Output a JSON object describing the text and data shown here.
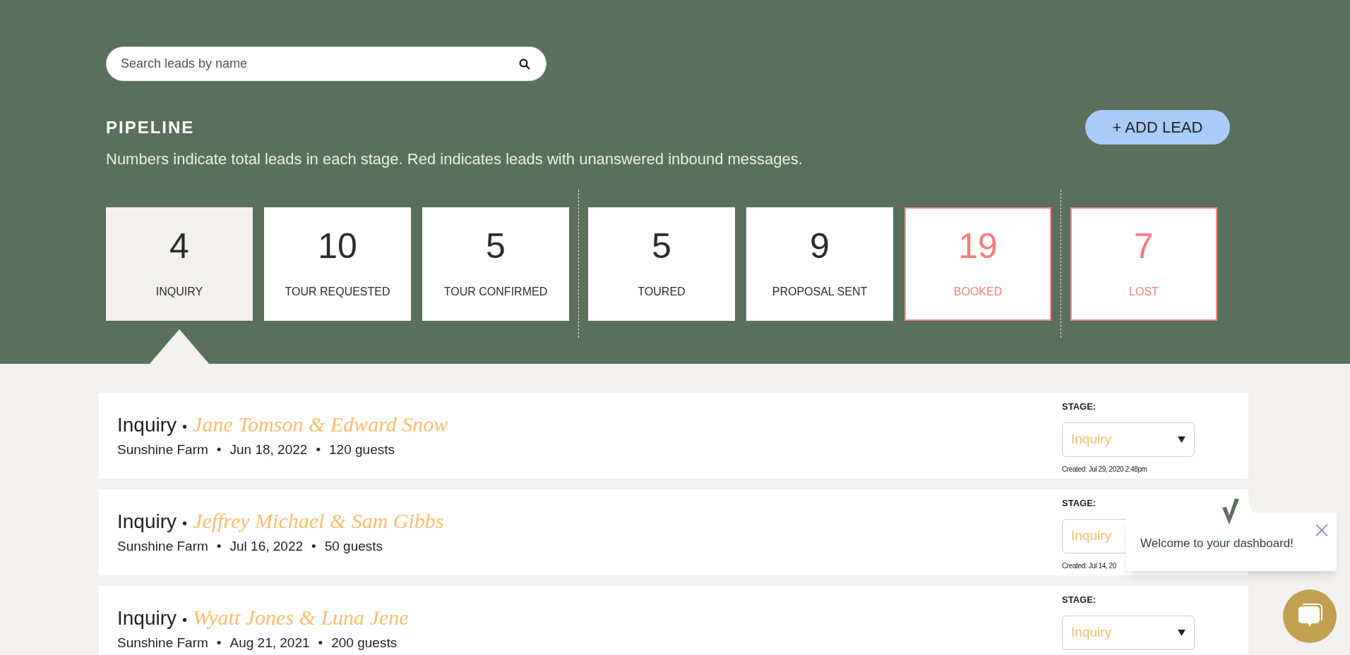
{
  "search": {
    "placeholder": "Search leads by name"
  },
  "pipeline": {
    "title": "PIPELINE",
    "description": "Numbers indicate total leads in each stage. Red indicates leads with unanswered inbound messages.",
    "add_button": "+ ADD LEAD",
    "stage_groups": [
      [
        {
          "count": "4",
          "label": "INQUIRY",
          "selected": true,
          "alert": false
        },
        {
          "count": "10",
          "label": "TOUR REQUESTED",
          "selected": false,
          "alert": false
        },
        {
          "count": "5",
          "label": "TOUR CONFIRMED",
          "selected": false,
          "alert": false
        }
      ],
      [
        {
          "count": "5",
          "label": "TOURED",
          "selected": false,
          "alert": false
        },
        {
          "count": "9",
          "label": "PROPOSAL SENT",
          "selected": false,
          "alert": false
        },
        {
          "count": "19",
          "label": "BOOKED",
          "selected": false,
          "alert": true
        }
      ],
      [
        {
          "count": "7",
          "label": "LOST",
          "selected": false,
          "alert": true
        }
      ]
    ]
  },
  "leads": [
    {
      "stage": "Inquiry",
      "separator": "•",
      "names": "Jane Tomson & Edward Snow",
      "venue": "Sunshine Farm",
      "date": "Jun 18, 2022",
      "guests": "120 guests",
      "stage_label": "STAGE:",
      "stage_value": "Inquiry",
      "created": "Created: Jul 29, 2020 2:48pm"
    },
    {
      "stage": "Inquiry",
      "separator": "•",
      "names": "Jeffrey Michael & Sam Gibbs",
      "venue": "Sunshine Farm",
      "date": "Jul 16, 2022",
      "guests": "50 guests",
      "stage_label": "STAGE:",
      "stage_value": "Inquiry",
      "created": "Created: Jul 14, 20"
    },
    {
      "stage": "Inquiry",
      "separator": "•",
      "names": "Wyatt Jones & Luna Jene",
      "venue": "Sunshine Farm",
      "date": "Aug 21, 2021",
      "guests": "200 guests",
      "stage_label": "STAGE:",
      "stage_value": "Inquiry"
    }
  ],
  "welcome_popup": {
    "message": "Welcome to your dashboard!"
  }
}
